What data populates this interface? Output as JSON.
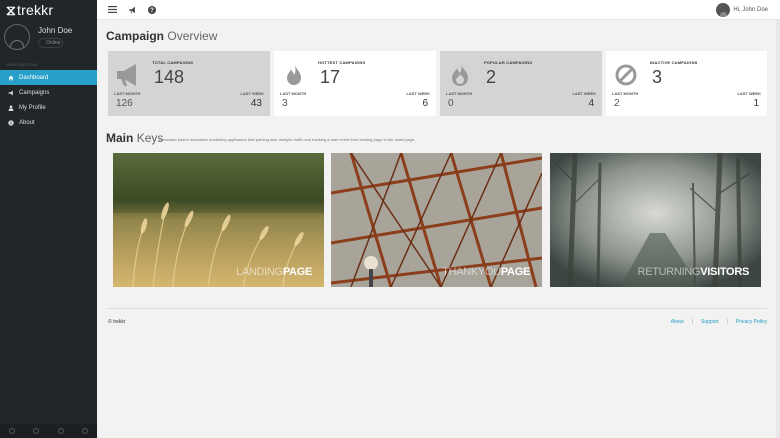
{
  "brand": {
    "logo_mark": "⧖",
    "name": "trekkr"
  },
  "user": {
    "name": "John Doe",
    "status": "Online"
  },
  "nav": {
    "heading": "NAVIGATION",
    "items": [
      {
        "label": "Dashboard",
        "icon": "home-icon",
        "active": true
      },
      {
        "label": "Campaigns",
        "icon": "megaphone-icon",
        "active": false
      },
      {
        "label": "My Profile",
        "icon": "user-icon",
        "active": false
      },
      {
        "label": "About",
        "icon": "info-icon",
        "active": false
      }
    ]
  },
  "topbar": {
    "greeting": "Hi, John Doe"
  },
  "page": {
    "title_bold": "Campaign",
    "title_light": "Overview"
  },
  "cards": [
    {
      "label": "TOTAL CAMPAIGNS",
      "value": "148",
      "last_month_label": "LAST MONTH",
      "last_month": "126",
      "last_week_label": "LAST WEEK",
      "last_week": "43",
      "icon": "megaphone-icon",
      "bg": "#d4d4d4"
    },
    {
      "label": "HOTTEST CAMPAIGNS",
      "value": "17",
      "last_month_label": "LAST MONTH",
      "last_month": "3",
      "last_week_label": "LAST WEEK",
      "last_week": "6",
      "icon": "flame-icon",
      "bg": "#ffffff"
    },
    {
      "label": "POPULAR CAMPAIGNS",
      "value": "2",
      "last_month_label": "LAST MONTH",
      "last_month": "0",
      "last_week_label": "LAST WEEK",
      "last_week": "4",
      "icon": "fire-icon",
      "bg": "#d4d4d4"
    },
    {
      "label": "INACTIVE CAMPAIGNS",
      "value": "3",
      "last_month_label": "LAST MONTH",
      "last_month": "2",
      "last_week_label": "LAST WEEK",
      "last_week": "1",
      "icon": "ban-icon",
      "bg": "#ffffff"
    }
  ],
  "keys": {
    "title_bold": "Main",
    "title_light": "Keys",
    "description": "A browser based innovative marketing application that parsing user analytic traffic and tracking a user event from landing page to the sales page."
  },
  "tiles": [
    {
      "light": "LANDING",
      "bold": "PAGE"
    },
    {
      "light": "THANKYOU",
      "bold": "PAGE"
    },
    {
      "light": "RETURNING",
      "bold": "VISITORS"
    }
  ],
  "footer": {
    "copyright": "© trekkr",
    "links": [
      "About",
      "Support",
      "Privacy Policy"
    ],
    "separator": "|"
  },
  "colors": {
    "accent": "#29a0c9",
    "sidebar": "#222629",
    "link": "#1f9cc2"
  }
}
